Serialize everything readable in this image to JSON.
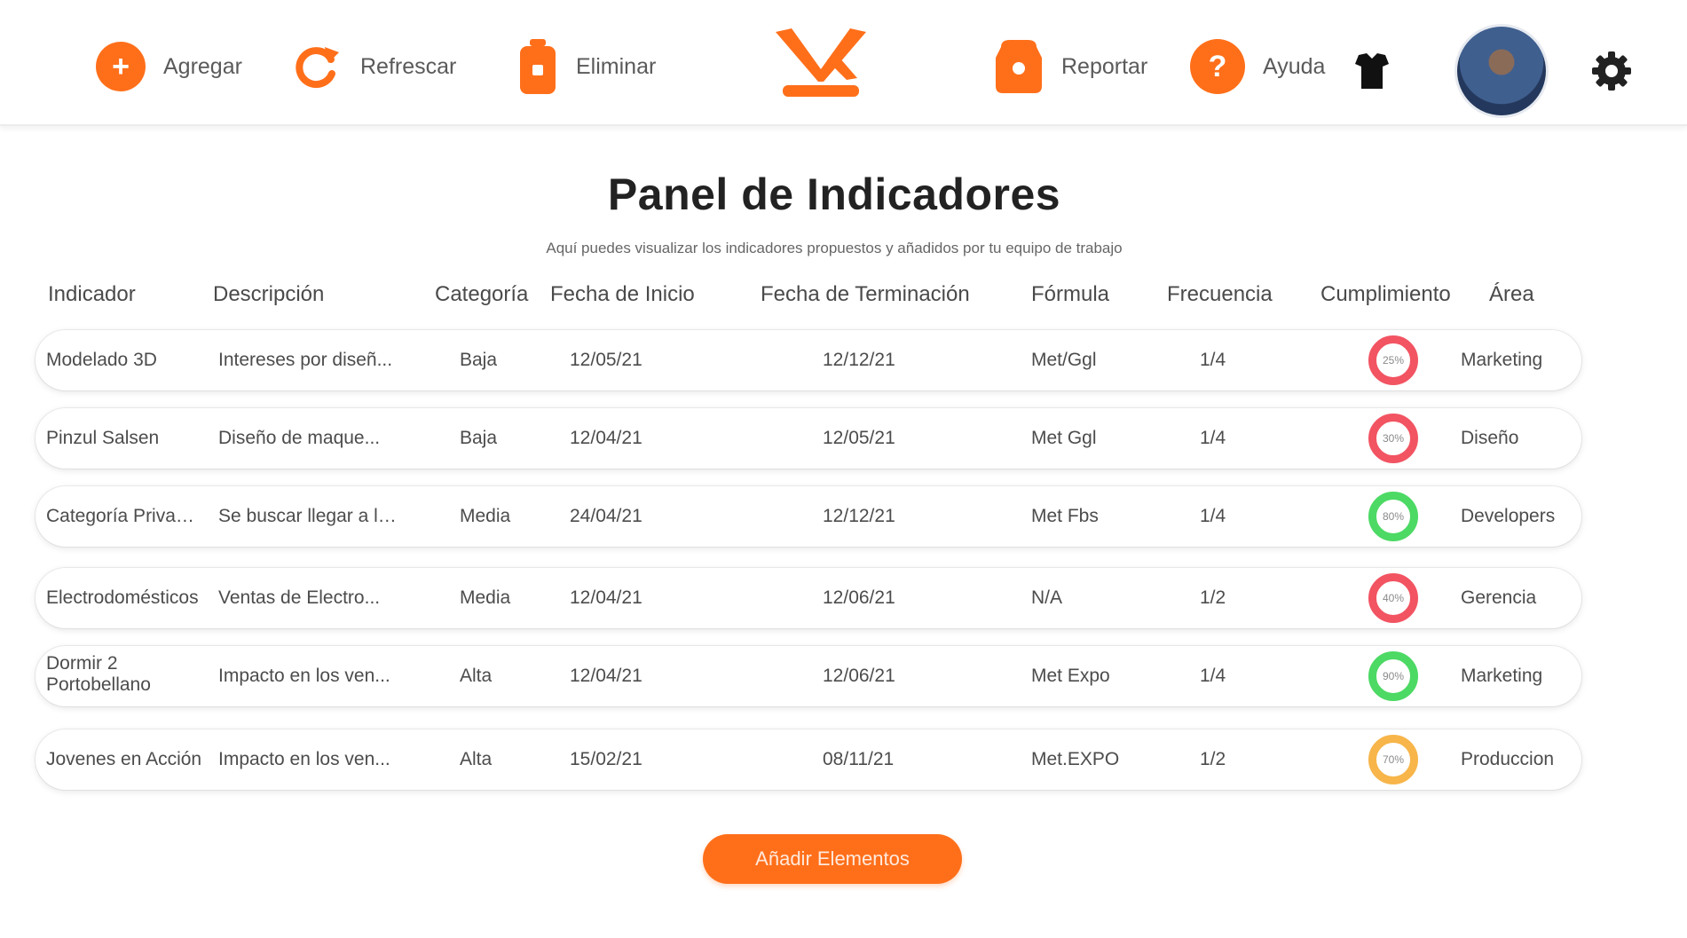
{
  "toolbar": {
    "add_label": "Agregar",
    "refresh_label": "Refrescar",
    "delete_label": "Eliminar",
    "report_label": "Reportar",
    "help_label": "Ayuda",
    "add_icon_glyph": "+",
    "help_icon_glyph": "?"
  },
  "page": {
    "title": "Panel de Indicadores",
    "subtitle": "Aquí puedes visualizar los indicadores propuestos y añadidos por tu equipo de trabajo"
  },
  "table": {
    "headers": [
      "Indicador",
      "Descripción",
      "Categoría",
      "Fecha de Inicio",
      "Fecha de Terminación",
      "Fórmula",
      "Frecuencia",
      "Cumplimiento",
      "Área"
    ],
    "rows": [
      {
        "indicador": "Modelado 3D",
        "descripcion": "Intereses por diseñ...",
        "categoria": "Baja",
        "inicio": "12/05/21",
        "fin": "12/12/21",
        "formula": "Met/Ggl",
        "frecuencia": "1/4",
        "cumplimiento": "25%",
        "status": "red",
        "area": "Marketing"
      },
      {
        "indicador": "Pinzul Salsen",
        "descripcion": "Diseño de maque...",
        "categoria": "Baja",
        "inicio": "12/04/21",
        "fin": "12/05/21",
        "formula": "Met Ggl",
        "frecuencia": "1/4",
        "cumplimiento": "30%",
        "status": "red",
        "area": "Diseño"
      },
      {
        "indicador": "Categoría Privados",
        "descripcion": "Se buscar llegar a los...",
        "categoria": "Media",
        "inicio": "24/04/21",
        "fin": "12/12/21",
        "formula": "Met Fbs",
        "frecuencia": "1/4",
        "cumplimiento": "80%",
        "status": "green",
        "area": "Developers"
      },
      {
        "indicador": "Electrodomésticos",
        "descripcion": "Ventas de Electro...",
        "categoria": "Media",
        "inicio": "12/04/21",
        "fin": "12/06/21",
        "formula": "N/A",
        "frecuencia": "1/2",
        "cumplimiento": "40%",
        "status": "red",
        "area": "Gerencia"
      },
      {
        "indicador": "Dormir 2 Portobellano",
        "descripcion": "Impacto en los ven...",
        "categoria": "Alta",
        "inicio": "12/04/21",
        "fin": "12/06/21",
        "formula": "Met Expo",
        "frecuencia": "1/4",
        "cumplimiento": "90%",
        "status": "green",
        "area": "Marketing"
      },
      {
        "indicador": "Jovenes en Acción",
        "descripcion": "Impacto en los ven...",
        "categoria": "Alta",
        "inicio": "15/02/21",
        "fin": "08/11/21",
        "formula": "Met.EXPO",
        "frecuencia": "1/2",
        "cumplimiento": "70%",
        "status": "orange",
        "area": "Produccion"
      }
    ]
  },
  "status_colors": {
    "red": "#f25462",
    "green": "#4cd964",
    "orange": "#f7b54a"
  },
  "accent": "#ff6f1a",
  "actions": {
    "add_element_label": "Añadir Elementos"
  }
}
